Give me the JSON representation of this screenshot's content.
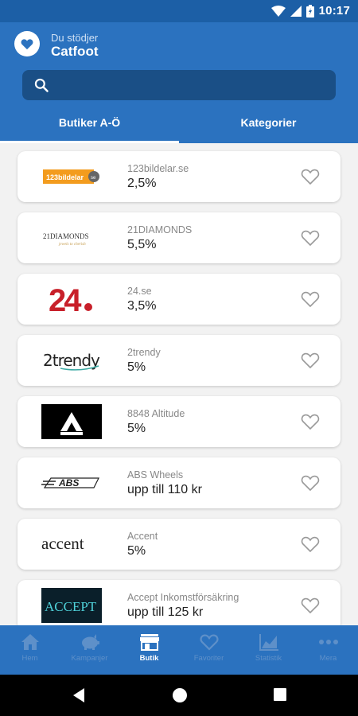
{
  "status": {
    "time": "10:17"
  },
  "header": {
    "supporting_label": "Du stödjer",
    "org_name": "Catfoot",
    "search": {
      "placeholder": "",
      "value": ""
    },
    "tabs": [
      {
        "label": "Butiker A-Ö",
        "active": true
      },
      {
        "label": "Kategorier",
        "active": false
      }
    ]
  },
  "stores": [
    {
      "name": "123bildelar.se",
      "rate": "2,5%",
      "logo": "123bildelar"
    },
    {
      "name": "21DIAMONDS",
      "rate": "5,5%",
      "logo": "21DIAMONDS"
    },
    {
      "name": "24.se",
      "rate": "3,5%",
      "logo": "24"
    },
    {
      "name": "2trendy",
      "rate": "5%",
      "logo": "2trendy"
    },
    {
      "name": "8848 Altitude",
      "rate": "5%",
      "logo": "8848"
    },
    {
      "name": "ABS Wheels",
      "rate": "upp till 110 kr",
      "logo": "ABS"
    },
    {
      "name": "Accent",
      "rate": "5%",
      "logo": "accent"
    },
    {
      "name": "Accept Inkomstförsäkring",
      "rate": "upp till 125 kr",
      "logo": "ACCEPT"
    }
  ],
  "nav": [
    {
      "label": "Hem",
      "icon": "home-icon",
      "active": false
    },
    {
      "label": "Kampanjer",
      "icon": "piggy-bank-icon",
      "active": false
    },
    {
      "label": "Butik",
      "icon": "store-icon",
      "active": true
    },
    {
      "label": "Favoriter",
      "icon": "heart-icon",
      "active": false
    },
    {
      "label": "Statistik",
      "icon": "chart-icon",
      "active": false
    },
    {
      "label": "Mera",
      "icon": "more-icon",
      "active": false
    }
  ],
  "colors": {
    "primary": "#2b72bf",
    "status_bar": "#1c5fa6",
    "search_bg": "#1a4f86",
    "inactive_nav": "#5e90c9"
  }
}
